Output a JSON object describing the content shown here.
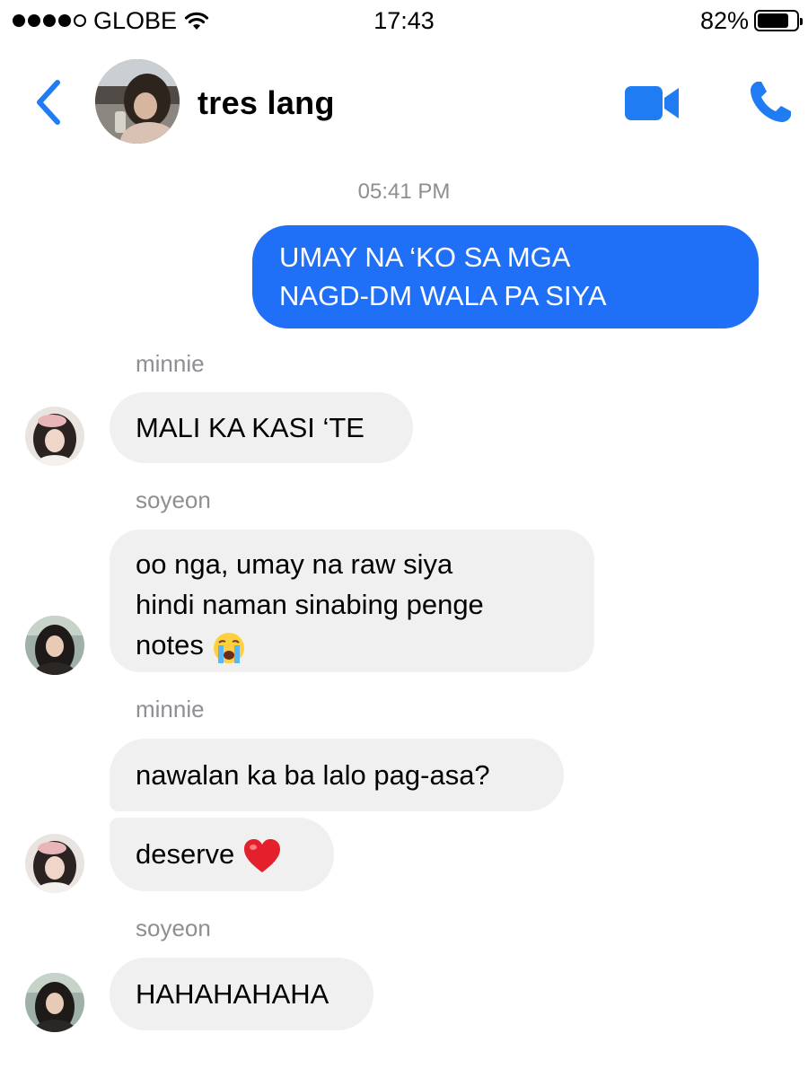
{
  "status_bar": {
    "carrier": "GLOBE",
    "time": "17:43",
    "battery_percent": "82%",
    "battery_level": 0.82,
    "signal_bars_filled": 4,
    "signal_bars_total": 5
  },
  "header": {
    "title": "tres lang",
    "back_icon": "chevron-left-icon",
    "video_icon": "video-camera-icon",
    "call_icon": "phone-icon",
    "accent_color": "#1f7cf2"
  },
  "conversation": {
    "timestamp": "05:41 PM",
    "messages": [
      {
        "direction": "outgoing",
        "lines": [
          "UMAY NA ‘KO SA MGA",
          "NAGD-DM WALA PA SIYA"
        ]
      },
      {
        "direction": "incoming",
        "sender": "minnie",
        "text": "MALI KA KASI ‘TE"
      },
      {
        "direction": "incoming",
        "sender": "soyeon",
        "lines": [
          "oo nga, umay na raw siya",
          "hindi naman sinabing penge",
          "notes"
        ],
        "emoji": "crying-face-emoji"
      },
      {
        "direction": "incoming",
        "sender": "minnie",
        "text": "nawalan ka ba lalo pag-asa?"
      },
      {
        "direction": "incoming",
        "sender": "minnie",
        "text": "deserve",
        "emoji": "red-heart-emoji"
      },
      {
        "direction": "incoming",
        "sender": "soyeon",
        "text": "HAHAHAHAHA"
      }
    ]
  },
  "colors": {
    "outgoing_bubble": "#1f6ff7",
    "incoming_bubble": "#f0f0f0",
    "meta_text": "#8e8e93"
  }
}
